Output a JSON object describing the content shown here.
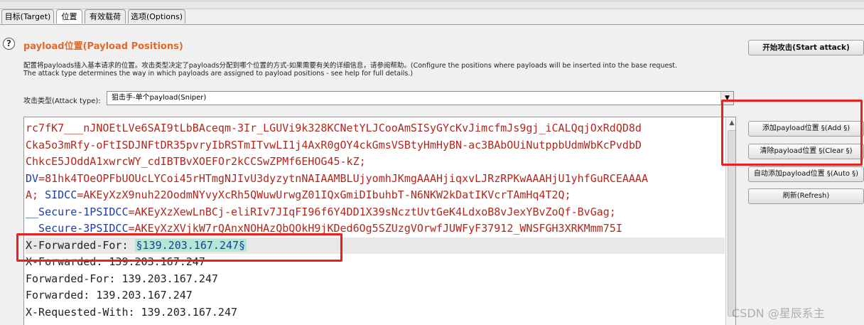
{
  "tabs": [
    {
      "label": "目标(Target)"
    },
    {
      "label": "位置"
    },
    {
      "label": "有效载荷"
    },
    {
      "label": "选项(Options)"
    }
  ],
  "section": {
    "title": "payload位置(Payload Positions)",
    "desc_line1": "配置将payloads插入基本请求的位置。攻击类型决定了payloads分配到哪个位置的方式-如果需要有关的详细信息，请参阅帮助。(Configure the positions where payloads will be inserted into the base request.",
    "desc_line2": "The attack type determines the way in which payloads are assigned to payload positions - see help for full details.)"
  },
  "attack_type": {
    "label": "攻击类型(Attack type):",
    "value": "狙击手-单个payload(Sniper)"
  },
  "buttons": {
    "start_attack": "开始攻击(Start attack)",
    "add": "添加payload位置 §(Add §)",
    "clear": "清除payload位置 §(Clear §)",
    "auto": "自动添加payload位置 §(Auto §)",
    "refresh": "刷新(Refresh)"
  },
  "request": {
    "line1": "rc7fK7___nJNOEtLVe6SAI9tLbBAceqm-3Ir_LGUVi9k328KCNetYLJCooAmSISyGYcKvJimcfmJs9gj_iCALQqjOxRdQD8d",
    "line2": "Cka5o3mRfy-oFtISDJNFtDR35pvryIbRSTmITvwLI1j4AxR0gOY4ckGmsVSBtyHmHyBN-ac3BAbOUiNutppbUdmWbKcPvdbD",
    "line3": "ChkcE5JOddA1xwrcWY_cdIBTBvXOEFOr2kCCSwZPMf6EHOG45-kZ;",
    "line4_key": "DV",
    "line4_val": "=81hk4TOeOPFbUOUcLYCoi45rHTmgNJIvU3dyzytnNAIAAMBLUjyomhJKmgAAAHjiqxvLJRzRPKwAAAHjU1yhfGuRCEAAAA",
    "line5_pre": "A; ",
    "line5_key": "SIDCC",
    "line5_val": "=AKEyXzX9nuh22OodmNYvyXcRh5QWuwUrwgZ01IQxGmiDIbuhbT-N6NKW2kDatIKVcrTAmHq4T2Q;",
    "line6_key": "__Secure-1PSIDCC",
    "line6_val": "=AKEyXzXewLnBCj-eliRIv7JIqFI96f6Y4DD1X39sNcztUvtGeK4LdxoB8vJexYBvZoQf-BvGag;",
    "line7_key": "__Secure-3PSIDCC",
    "line7_val": "=AKEyXzXVjkW7rQAnxNOHAzQbQOkH9jKDed6Og5SZUzgVOrwfJUWFyF37912_WNSFGH3XRKMmm75I",
    "line8_key": "X-Forwarded-For: ",
    "line8_payload": "§139.203.167.247§",
    "line9": "X-Forwarded: 139.203.167.247",
    "line10": "Forwarded-For: 139.203.167.247",
    "line11": "Forwarded: 139.203.167.247",
    "line12": "X-Requested-With: 139.203.167.247"
  },
  "watermark": "CSDN @星辰系主",
  "colors": {
    "section_title": "#e06a2c",
    "highlight_box": "#e8201e",
    "payload_bg": "#b6e6d4"
  }
}
